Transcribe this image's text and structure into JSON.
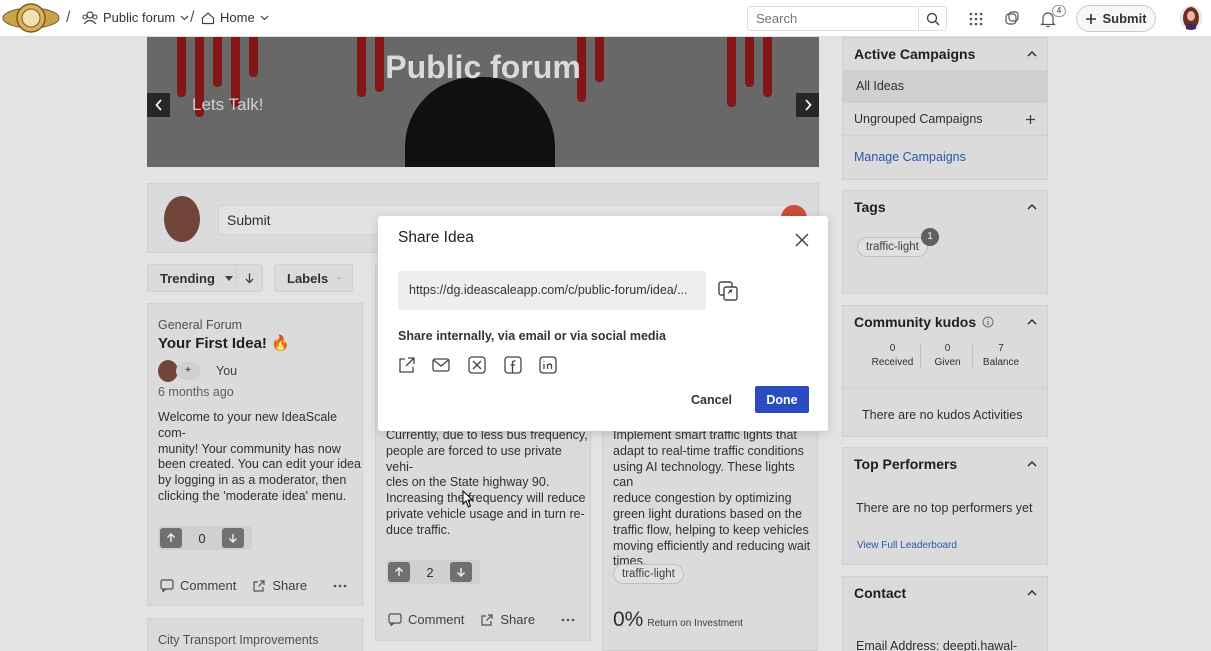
{
  "header": {
    "breadcrumb": [
      {
        "label": "Public forum",
        "icon": "community-icon"
      },
      {
        "label": "Home",
        "icon": "home-icon"
      }
    ],
    "search_placeholder": "Search",
    "notification_count": "4",
    "submit_label": "Submit"
  },
  "banner": {
    "title": "Public forum",
    "subtitle": "Lets Talk!"
  },
  "submit_box": {
    "placeholder": "Submit"
  },
  "filters": {
    "sort_label": "Trending",
    "labels_label": "Labels"
  },
  "cards": [
    {
      "category": "General Forum",
      "title": "Your First Idea!",
      "author": "You",
      "time": "6 months ago",
      "body": [
        "Welcome to your new IdeaScale com-",
        "munity! Your community has now",
        "been created. You can edit your idea",
        "by logging in as a moderator, then",
        "clicking the 'moderate idea' menu."
      ],
      "votes": "0",
      "comment_label": "Comment",
      "share_label": "Share"
    },
    {
      "body": [
        "Currently, due to less bus frequency,",
        "people are forced to use private vehi-",
        "cles on the State highway 90.",
        "Increasing the frequency will reduce",
        "private vehicle usage and in turn re-",
        "duce traffic."
      ],
      "votes": "2",
      "comment_label": "Comment",
      "share_label": "Share"
    },
    {
      "body": [
        "Implement smart traffic lights that",
        "adapt to real-time traffic conditions",
        "using AI technology. These lights can",
        "reduce congestion by optimizing",
        "green light durations based on the",
        "traffic flow, helping to keep vehicles",
        "moving efficiently and reducing wait",
        "times."
      ],
      "tag": "traffic-light",
      "roi_value": "0%",
      "roi_label": "Return on Investment"
    },
    {
      "category": "City Transport Improvements"
    }
  ],
  "sidebar": {
    "campaigns": {
      "title": "Active Campaigns",
      "items": [
        "All Ideas",
        "Ungrouped Campaigns"
      ],
      "manage_link": "Manage Campaigns"
    },
    "tags": {
      "title": "Tags",
      "tag": "traffic-light",
      "count": "1"
    },
    "kudos": {
      "title": "Community kudos",
      "stats": [
        {
          "value": "0",
          "label": "Received"
        },
        {
          "value": "0",
          "label": "Given"
        },
        {
          "value": "7",
          "label": "Balance"
        }
      ],
      "empty_text": "There are no kudos Activities"
    },
    "performers": {
      "title": "Top Performers",
      "empty_text": "There are no top performers yet",
      "link": "View Full Leaderboard"
    },
    "contact": {
      "title": "Contact",
      "email_text": "Email Address: deepti.hawal-"
    }
  },
  "modal": {
    "title": "Share Idea",
    "url": "https://dg.ideascaleapp.com/c/public-forum/idea/...",
    "share_text": "Share internally, via email or via social media",
    "cancel_label": "Cancel",
    "done_label": "Done"
  },
  "colors": {
    "primary_button": "#2b4cc0",
    "link": "#2f5bb7"
  }
}
